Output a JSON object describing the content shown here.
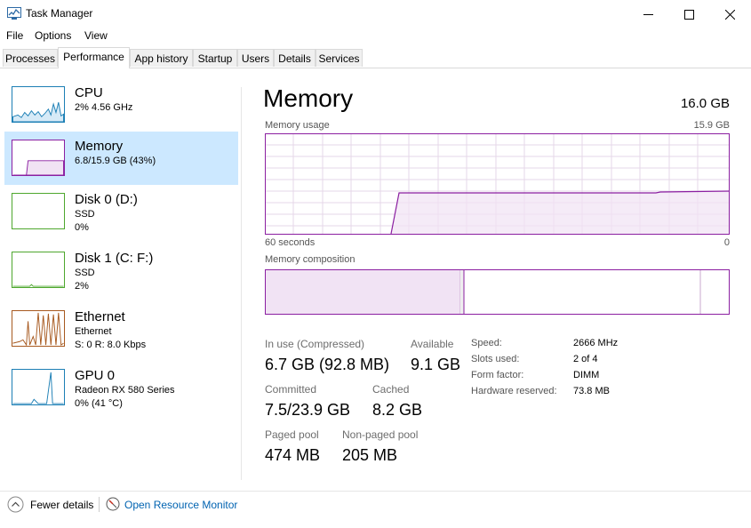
{
  "window": {
    "title": "Task Manager"
  },
  "menu": [
    "File",
    "Options",
    "View"
  ],
  "tabs": [
    "Processes",
    "Performance",
    "App history",
    "Startup",
    "Users",
    "Details",
    "Services"
  ],
  "sidebar": [
    {
      "name": "CPU",
      "sub1": "2%  4.56 GHz",
      "color": "#1c7fb5"
    },
    {
      "name": "Memory",
      "sub1": "6.8/15.9 GB (43%)",
      "color": "#8b1fa1"
    },
    {
      "name": "Disk 0 (D:)",
      "sub1": "SSD",
      "sub2": "0%",
      "color": "#4ea72e"
    },
    {
      "name": "Disk 1 (C: F:)",
      "sub1": "SSD",
      "sub2": "2%",
      "color": "#4ea72e"
    },
    {
      "name": "Ethernet",
      "sub1": "Ethernet",
      "sub2": "S: 0  R: 8.0 Kbps",
      "color": "#a7591f"
    },
    {
      "name": "GPU 0",
      "sub1": "Radeon RX 580 Series",
      "sub2": "0% (41 °C)",
      "color": "#1c7fb5"
    }
  ],
  "main": {
    "title": "Memory",
    "total": "16.0 GB",
    "usage_label": "Memory usage",
    "usage_max": "15.9 GB",
    "axis_left": "60 seconds",
    "axis_right": "0",
    "composition_label": "Memory composition",
    "stats": {
      "in_use_label": "In use (Compressed)",
      "in_use_value": "6.7 GB (92.8 MB)",
      "available_label": "Available",
      "available_value": "9.1 GB",
      "committed_label": "Committed",
      "committed_value": "7.5/23.9 GB",
      "cached_label": "Cached",
      "cached_value": "8.2 GB",
      "paged_label": "Paged pool",
      "paged_value": "474 MB",
      "nonpaged_label": "Non-paged pool",
      "nonpaged_value": "205 MB"
    },
    "specs": [
      {
        "label": "Speed:",
        "value": "2666 MHz"
      },
      {
        "label": "Slots used:",
        "value": "2 of 4"
      },
      {
        "label": "Form factor:",
        "value": "DIMM"
      },
      {
        "label": "Hardware reserved:",
        "value": "73.8 MB"
      }
    ]
  },
  "footer": {
    "fewer_details": "Fewer details",
    "resource_monitor": "Open Resource Monitor"
  },
  "colors": {
    "memory_accent": "#8b1fa1",
    "selection": "#cce8ff",
    "link": "#0063b1"
  }
}
